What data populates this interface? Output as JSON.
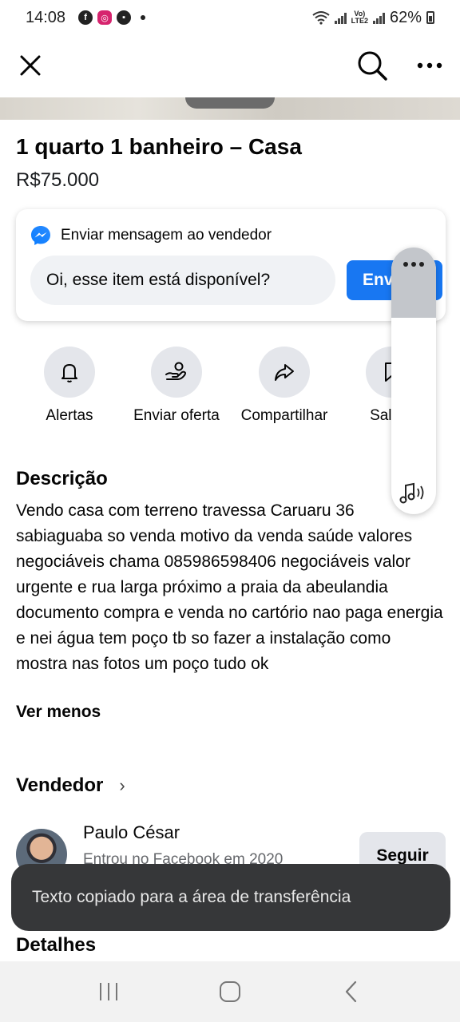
{
  "status_bar": {
    "time": "14:08",
    "battery": "62%"
  },
  "listing": {
    "title": "1 quarto 1 banheiro – Casa",
    "price": "R$75.000"
  },
  "message": {
    "header": "Enviar mensagem ao vendedor",
    "input_value": "Oi, esse item está disponível?",
    "send_label": "Enviar"
  },
  "actions": [
    {
      "label": "Alertas",
      "icon": "bell-icon"
    },
    {
      "label": "Enviar oferta",
      "icon": "offer-hand-icon"
    },
    {
      "label": "Compartilhar",
      "icon": "share-icon"
    },
    {
      "label": "Salvar",
      "icon": "bookmark-icon"
    }
  ],
  "description": {
    "title": "Descrição",
    "text": "Vendo casa com terreno  travessa Caruaru 36 sabiaguaba so venda motivo da venda saúde valores negociáveis chama 085986598406 negociáveis valor urgente e rua larga próximo a praia da abeulandia documento compra e venda no cartório nao paga energia e nei água tem poço tb so fazer a instalação como mostra nas fotos um poço tudo ok",
    "toggle": "Ver menos"
  },
  "seller": {
    "section_title": "Vendedor",
    "name": "Paulo César",
    "joined": "Entrou no Facebook em 2020",
    "follow_label": "Seguir"
  },
  "toast": {
    "text": "Texto copiado para a área de transferência"
  },
  "details": {
    "title": "Detalhes"
  },
  "colors": {
    "accent": "#1877f2",
    "toast_bg": "#363739"
  }
}
